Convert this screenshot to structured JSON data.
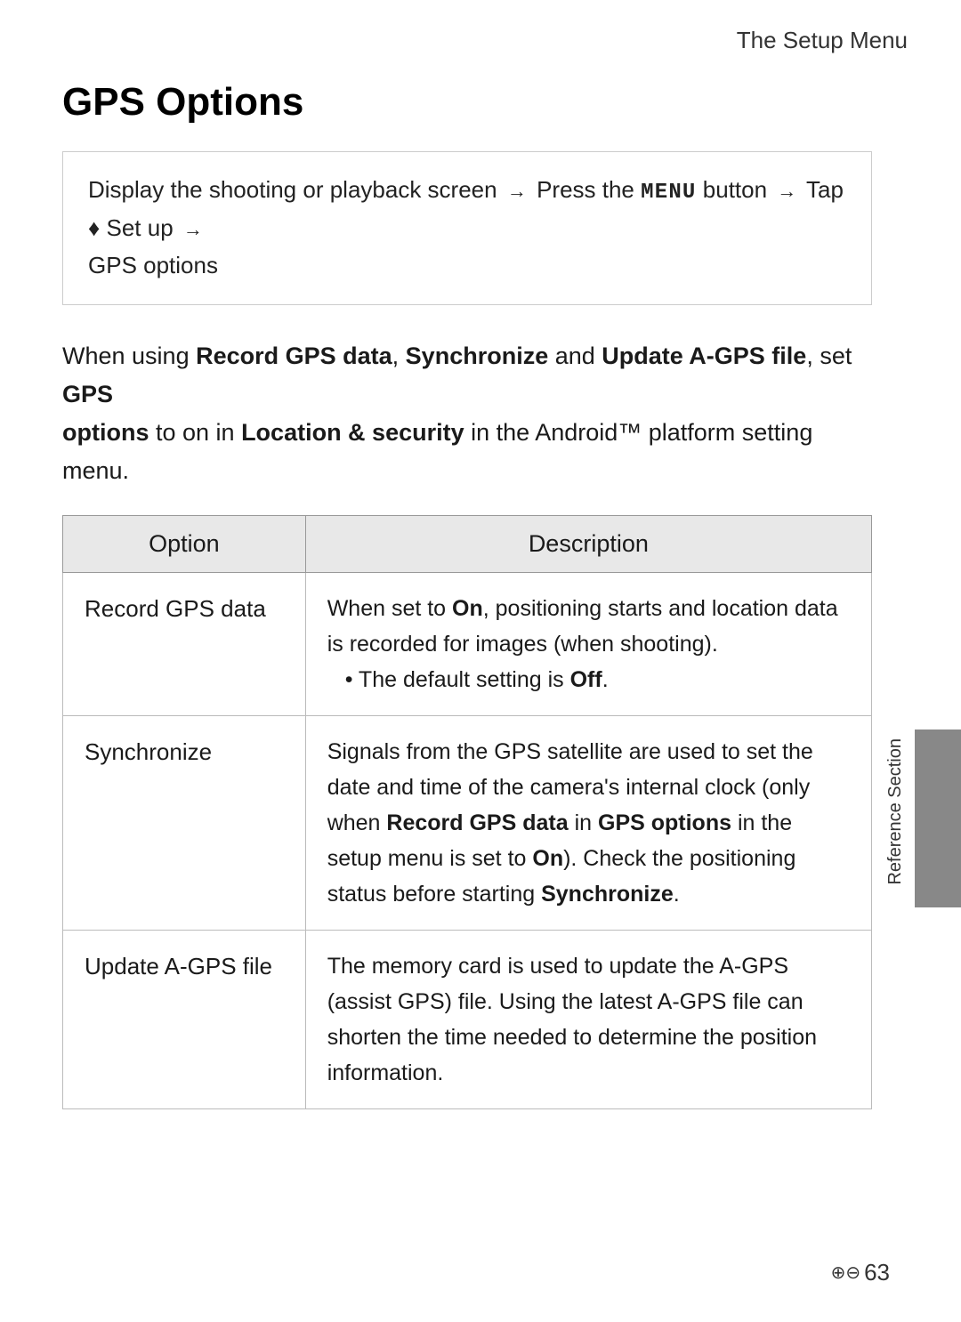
{
  "header": {
    "title": "The Setup Menu"
  },
  "page_title": "GPS Options",
  "navigation": {
    "text_before": "Display the shooting or playback screen",
    "arrow1": "→",
    "step1": "Press the",
    "menu_button": "MENU",
    "step2": "button",
    "arrow2": "→",
    "step3": "Tap",
    "setup_icon": "♦",
    "step4": "Set up",
    "arrow3": "→",
    "step5": "GPS options"
  },
  "intro": {
    "text1": "When using ",
    "bold1": "Record GPS data",
    "text2": ", ",
    "bold2": "Synchronize",
    "text3": " and ",
    "bold3": "Update A-GPS file",
    "text4": ", set ",
    "bold4": "GPS options",
    "text5": " to on in ",
    "bold5": "Location & security",
    "text6": " in the Android™ platform setting menu."
  },
  "table": {
    "col1_header": "Option",
    "col2_header": "Description",
    "rows": [
      {
        "option": "Record GPS data",
        "description_parts": [
          {
            "text": "When set to ",
            "normal": true
          },
          {
            "text": "On",
            "bold": true
          },
          {
            "text": ", positioning starts and location data is recorded for images (when shooting).",
            "normal": true
          }
        ],
        "bullet": "The default setting is ",
        "bullet_bold": "Off",
        "bullet_end": "."
      },
      {
        "option": "Synchronize",
        "description": "Signals from the GPS satellite are used to set the date and time of the camera's internal clock (only when ",
        "bold1": "Record GPS data",
        "mid1": " in ",
        "bold2": "GPS options",
        "mid2": " in the setup menu is set to ",
        "bold3": "On",
        "end1": "). Check the positioning status before starting ",
        "bold4": "Synchronize",
        "end2": "."
      },
      {
        "option": "Update A-GPS file",
        "description": "The memory card is used to update the A-GPS (assist GPS) file. Using the latest A-GPS file can shorten the time needed to determine the position information."
      }
    ]
  },
  "sidebar": {
    "label": "Reference Section"
  },
  "page_number": {
    "prefix": "❻❿",
    "number": "63"
  }
}
